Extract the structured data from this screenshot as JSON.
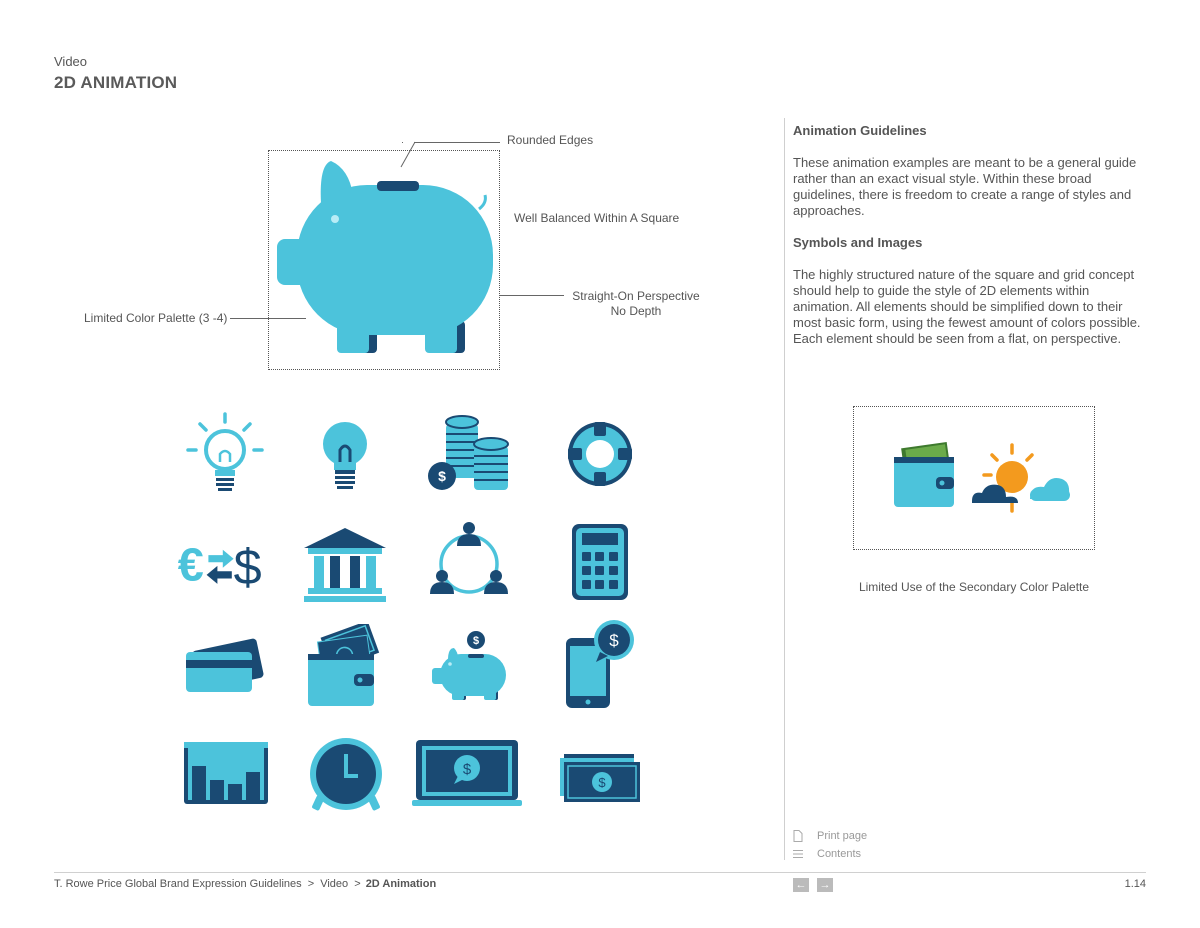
{
  "header": {
    "section": "Video",
    "title": "2D ANIMATION"
  },
  "callouts": {
    "rounded_edges": "Rounded Edges",
    "well_balanced": "Well Balanced Within A Square",
    "straight_on_1": "Straight-On Perspective",
    "straight_on_2": "No Depth",
    "limited_palette": "Limited Color Palette (3 -4)"
  },
  "guidelines": {
    "heading": "Animation Guidelines",
    "body": "These animation examples are meant to be a general guide rather than an exact visual style. Within these broad guidelines, there is freedom to create a range of styles and approaches."
  },
  "symbols": {
    "heading": "Symbols and Images",
    "body": "The highly structured nature of the square and grid concept should help to guide the style of 2D elements within animation. All elements should be simplified down to their most basic form, using the fewest amount of colors possible. Each element should be seen from a flat, on perspective."
  },
  "secondary_caption": "Limited Use of the Secondary Color Palette",
  "sidebar": {
    "print_label": "Print page",
    "contents_label": "Contents"
  },
  "footer": {
    "crumb_root": "T. Rowe Price Global Brand Expression Guidelines",
    "sep1": ">",
    "crumb_video": "Video",
    "sep2": ">",
    "crumb_current": "2D Animation",
    "page_number": "1.14"
  },
  "colors": {
    "light_blue": "#4cc3db",
    "dark_blue": "#1a4a73",
    "mid_blue": "#2b6c9a",
    "green": "#5a9a3e",
    "orange": "#f39a1e"
  },
  "icons": [
    "lightbulb-outline-icon",
    "lightbulb-icon",
    "coin-stacks-icon",
    "life-ring-icon",
    "currency-exchange-icon",
    "bank-icon",
    "network-people-icon",
    "calculator-icon",
    "credit-cards-icon",
    "wallet-cash-icon",
    "piggy-bank-coin-icon",
    "phone-dollar-icon",
    "bar-chart-icon",
    "alarm-clock-icon",
    "laptop-dollar-icon",
    "banknotes-icon"
  ]
}
